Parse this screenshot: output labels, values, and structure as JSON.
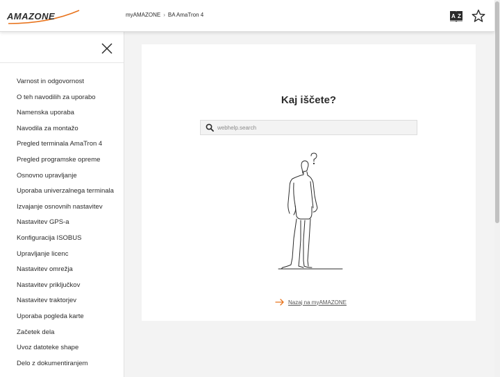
{
  "header": {
    "logo_text": "AMAZONE",
    "brand_color": "#e8731c",
    "breadcrumb": [
      "myAMAZONE",
      "BA AmaTron 4"
    ],
    "breadcrumb_separator": "›",
    "icons": [
      "book-az-icon",
      "star-icon"
    ]
  },
  "sidebar": {
    "close_icon": "close-icon",
    "items": [
      {
        "label": "Varnost in odgovornost"
      },
      {
        "label": "O teh navodilih za uporabo"
      },
      {
        "label": "Namenska uporaba"
      },
      {
        "label": "Navodila za montažo"
      },
      {
        "label": "Pregled terminala AmaTron 4"
      },
      {
        "label": "Pregled programske opreme"
      },
      {
        "label": "Osnovno upravljanje"
      },
      {
        "label": "Uporaba univerzalnega terminala"
      },
      {
        "label": "Izvajanje osnovnih nastavitev"
      },
      {
        "label": "Nastavitev GPS-a"
      },
      {
        "label": "Konfiguracija ISOBUS"
      },
      {
        "label": "Upravljanje licenc"
      },
      {
        "label": "Nastavitev omrežja"
      },
      {
        "label": "Nastavitev priključkov"
      },
      {
        "label": "Nastavitev traktorjev"
      },
      {
        "label": "Uporaba pogleda karte"
      },
      {
        "label": "Začetek dela"
      },
      {
        "label": "Uvoz datoteke shape"
      },
      {
        "label": "Delo z dokumentiranjem"
      }
    ]
  },
  "main": {
    "title": "Kaj iščete?",
    "search": {
      "placeholder": "webhelp.search",
      "value": ""
    },
    "back_link": "Nazaj na myAMAZONE",
    "illustration": "person-looking-up-question-mark"
  }
}
